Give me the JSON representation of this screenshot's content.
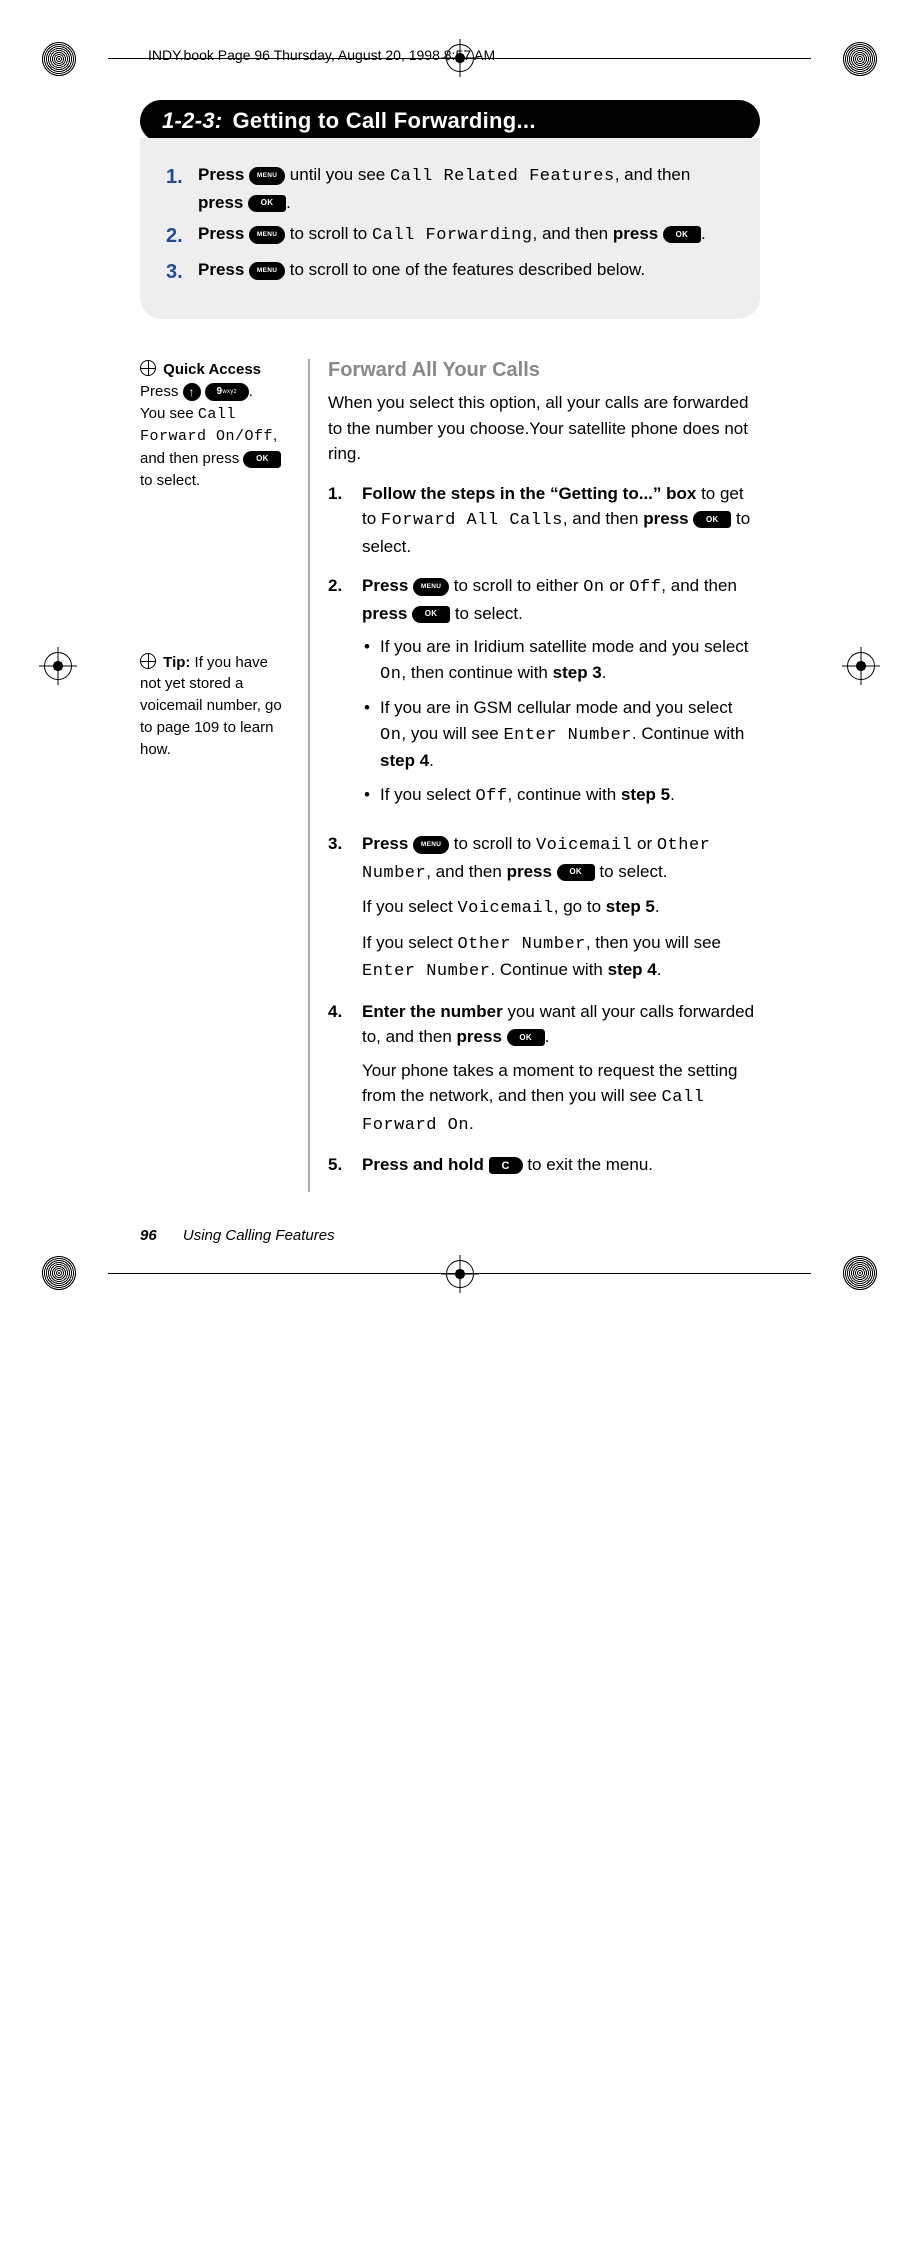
{
  "running_head": "INDY.book  Page 96  Thursday, August 20, 1998  8:57 AM",
  "heading": {
    "number": "1-2-3:",
    "title": "Getting to Call Forwarding..."
  },
  "box_steps": [
    {
      "pre": "Press ",
      "key1": "menu",
      "mid": " until you see ",
      "lcd": "Call Related Features",
      "post_pre": ", and then ",
      "bold2": "press ",
      "key2": "ok",
      "tail": "."
    },
    {
      "pre": "Press ",
      "key1": "menu",
      "mid": " to scroll to ",
      "lcd": "Call Forwarding",
      "post_pre": ", and then ",
      "bold2": "press ",
      "key2": "ok",
      "tail": "."
    },
    {
      "pre": "Press ",
      "key1": "menu",
      "mid": " to scroll to one of the features described below.",
      "lcd": "",
      "post_pre": "",
      "bold2": "",
      "key2": "",
      "tail": ""
    }
  ],
  "sidebar": {
    "quick_access": {
      "label": "Quick Access",
      "l1a": "Press ",
      "l1b": ".",
      "l2a": "You see ",
      "lcd1": "Call Forward On/Off",
      "l2b": ", and then press ",
      "l2c": " to select."
    },
    "tip": {
      "label": "Tip:",
      "text": " If you have not yet stored a voicemail number, go to page 109 to learn how."
    }
  },
  "section_title": "Forward All Your Calls",
  "intro": "When you select this option, all your calls are forwarded to the number you choose.Your satellite phone does not ring.",
  "steps": {
    "s1": {
      "bold": "Follow the steps in the “Getting to...” box",
      "a": " to get to ",
      "lcd": "Forward All Calls",
      "b": ", and then ",
      "bold2": "press ",
      "c": " to select."
    },
    "s2": {
      "bold": "Press ",
      "a": " to scroll to either ",
      "lcd_on": "On",
      "or": " or ",
      "lcd_off": "Off",
      "b": ", and then ",
      "bold2": "press ",
      "c": " to select.",
      "bul1a": "If you are in Iridium satellite mode and you select ",
      "bul1b": ", then continue with ",
      "bul1c": "step 3",
      "bul1d": ".",
      "bul2a": "If you are in GSM cellular mode and you select ",
      "bul2b": ", you will see ",
      "bul2lcd": "Enter Number",
      "bul2c": ". Continue with ",
      "bul2d": "step 4",
      "bul2e": ".",
      "bul3a": "If you select ",
      "bul3b": ", continue with ",
      "bul3c": "step 5",
      "bul3d": "."
    },
    "s3": {
      "bold": " Press ",
      "a": " to scroll to ",
      "lcd1": "Voicemail",
      "or": " or ",
      "lcd2": "Other Number",
      "b": ", and then ",
      "bold2": "press ",
      "c": " to select.",
      "p1a": "If you select ",
      "p1lcd": "Voicemail",
      "p1b": ", go to ",
      "p1c": "step 5",
      "p1d": ".",
      "p2a": "If you select ",
      "p2lcd": "Other Number",
      "p2b": ", then you will see ",
      "p2lcd2": "Enter Number",
      "p2c": ". Continue with ",
      "p2d": "step 4",
      "p2e": "."
    },
    "s4": {
      "bold": "Enter the number",
      "a": " you want all your calls forwarded to, and then ",
      "bold2": "press ",
      "b": ".",
      "p1": "Your phone takes a moment to request the setting from the network, and then you will see ",
      "lcd": "Call Forward On",
      "p2": "."
    },
    "s5": {
      "bold": "Press and hold ",
      "a": " to exit the menu."
    }
  },
  "footer": {
    "page": "96",
    "chapter": "Using Calling Features"
  }
}
